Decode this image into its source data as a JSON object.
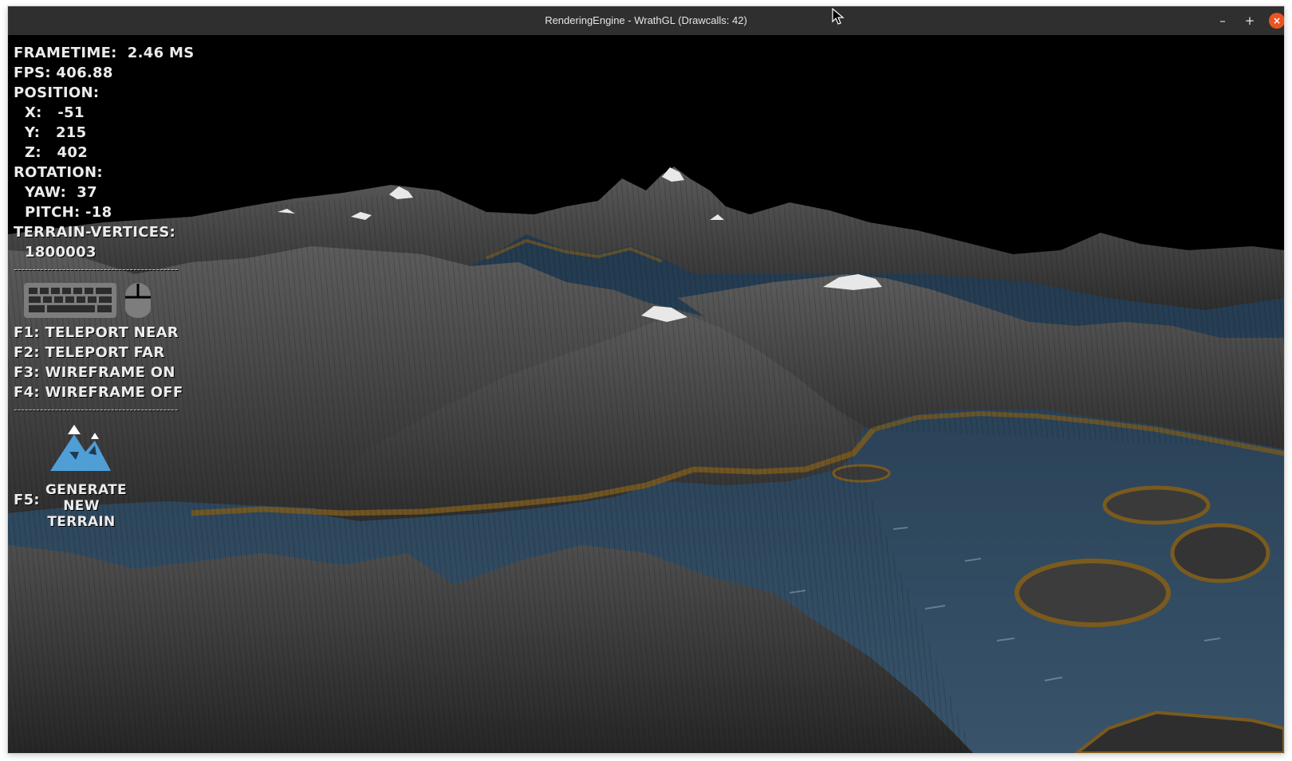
{
  "window": {
    "title": "RenderingEngine - WrathGL (Drawcalls: 42)",
    "controls": {
      "minimize": "–",
      "maximize": "+",
      "close": "×"
    }
  },
  "hud": {
    "frametime": "FRAMETIME:  2.46 MS",
    "fps": "FPS: 406.88",
    "position_label": "POSITION:",
    "x": "X:   -51",
    "y": "Y:   215",
    "z": "Z:   402",
    "rotation_label": "ROTATION:",
    "yaw": "YAW:  37",
    "pitch": "PITCH: -18",
    "vertices_label": "TERRAIN-VERTICES:",
    "vertices": "1800003",
    "separator": "--------------------------------------------",
    "input_icons": [
      "keyboard-icon",
      "mouse-icon"
    ],
    "keys": {
      "f1": "F1: TELEPORT NEAR",
      "f2": "F2: TELEPORT FAR",
      "f3": "F3: WIREFRAME ON",
      "f4": "F4: WIREFRAME OFF"
    },
    "generate": {
      "key": "F5:",
      "line1": "GENERATE",
      "line2": "NEW",
      "line3": "TERRAIN",
      "icon": "mountain-icon"
    }
  },
  "colors": {
    "titlebar": "#2f2f2f",
    "close_button": "#e95420",
    "sky": "#000000",
    "water": "#2b4256",
    "rock": "#4a4a4a",
    "shore": "#7a5a1e",
    "snow": "#e8e8e8",
    "mountain_icon": "#4f9fd6"
  }
}
